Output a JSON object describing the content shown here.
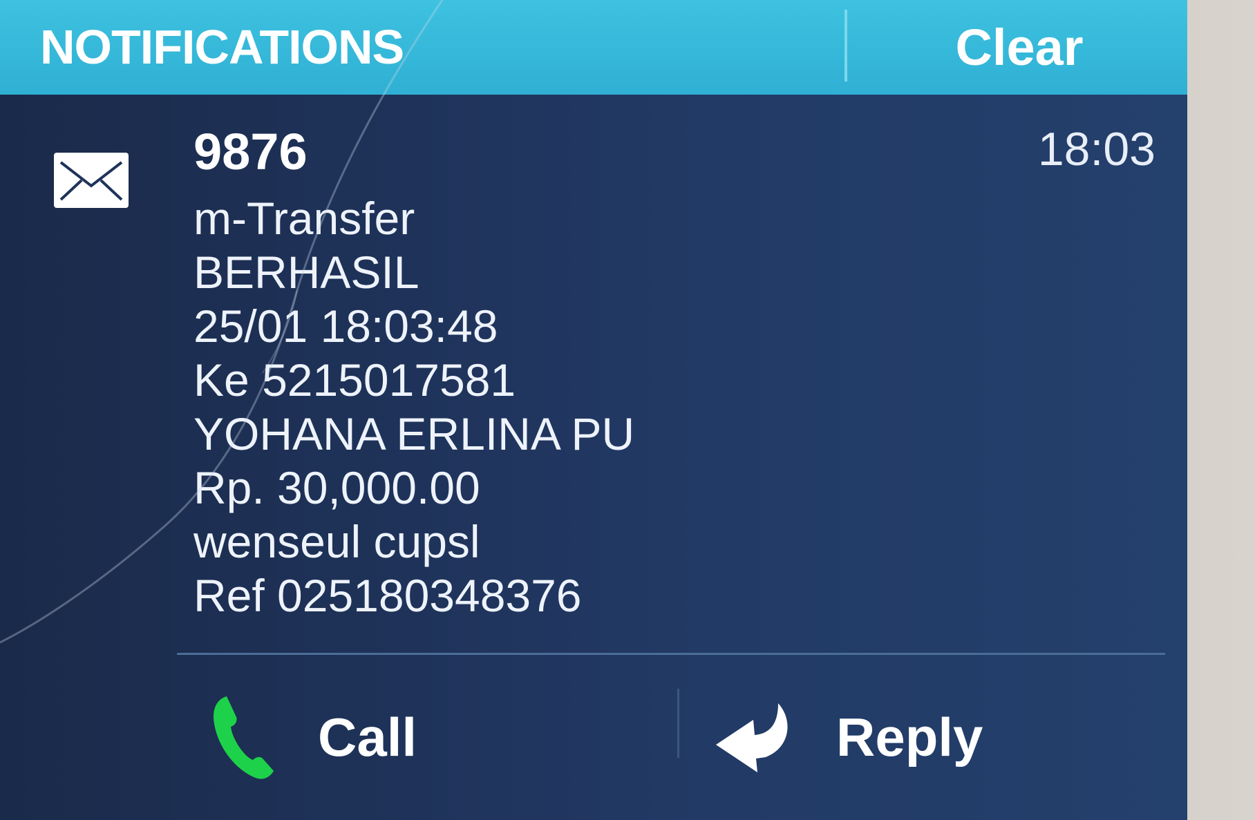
{
  "header": {
    "title": "NOTIFICATIONS",
    "clear_label": "Clear"
  },
  "notification": {
    "icon": "envelope-icon",
    "sender": "9876",
    "time": "18:03",
    "lines": [
      "m-Transfer",
      "BERHASIL",
      "25/01 18:03:48",
      "Ke 5215017581",
      "YOHANA ERLINA PU",
      "Rp. 30,000.00",
      "wenseul cupsl",
      "Ref 025180348376"
    ]
  },
  "actions": {
    "call_label": "Call",
    "call_icon": "phone-icon",
    "reply_label": "Reply",
    "reply_icon": "reply-arrow-icon"
  },
  "colors": {
    "header_bg": "#3ec2e0",
    "panel_bg": "#1f335a",
    "call_icon": "#1ed14a",
    "text": "#ffffff"
  }
}
